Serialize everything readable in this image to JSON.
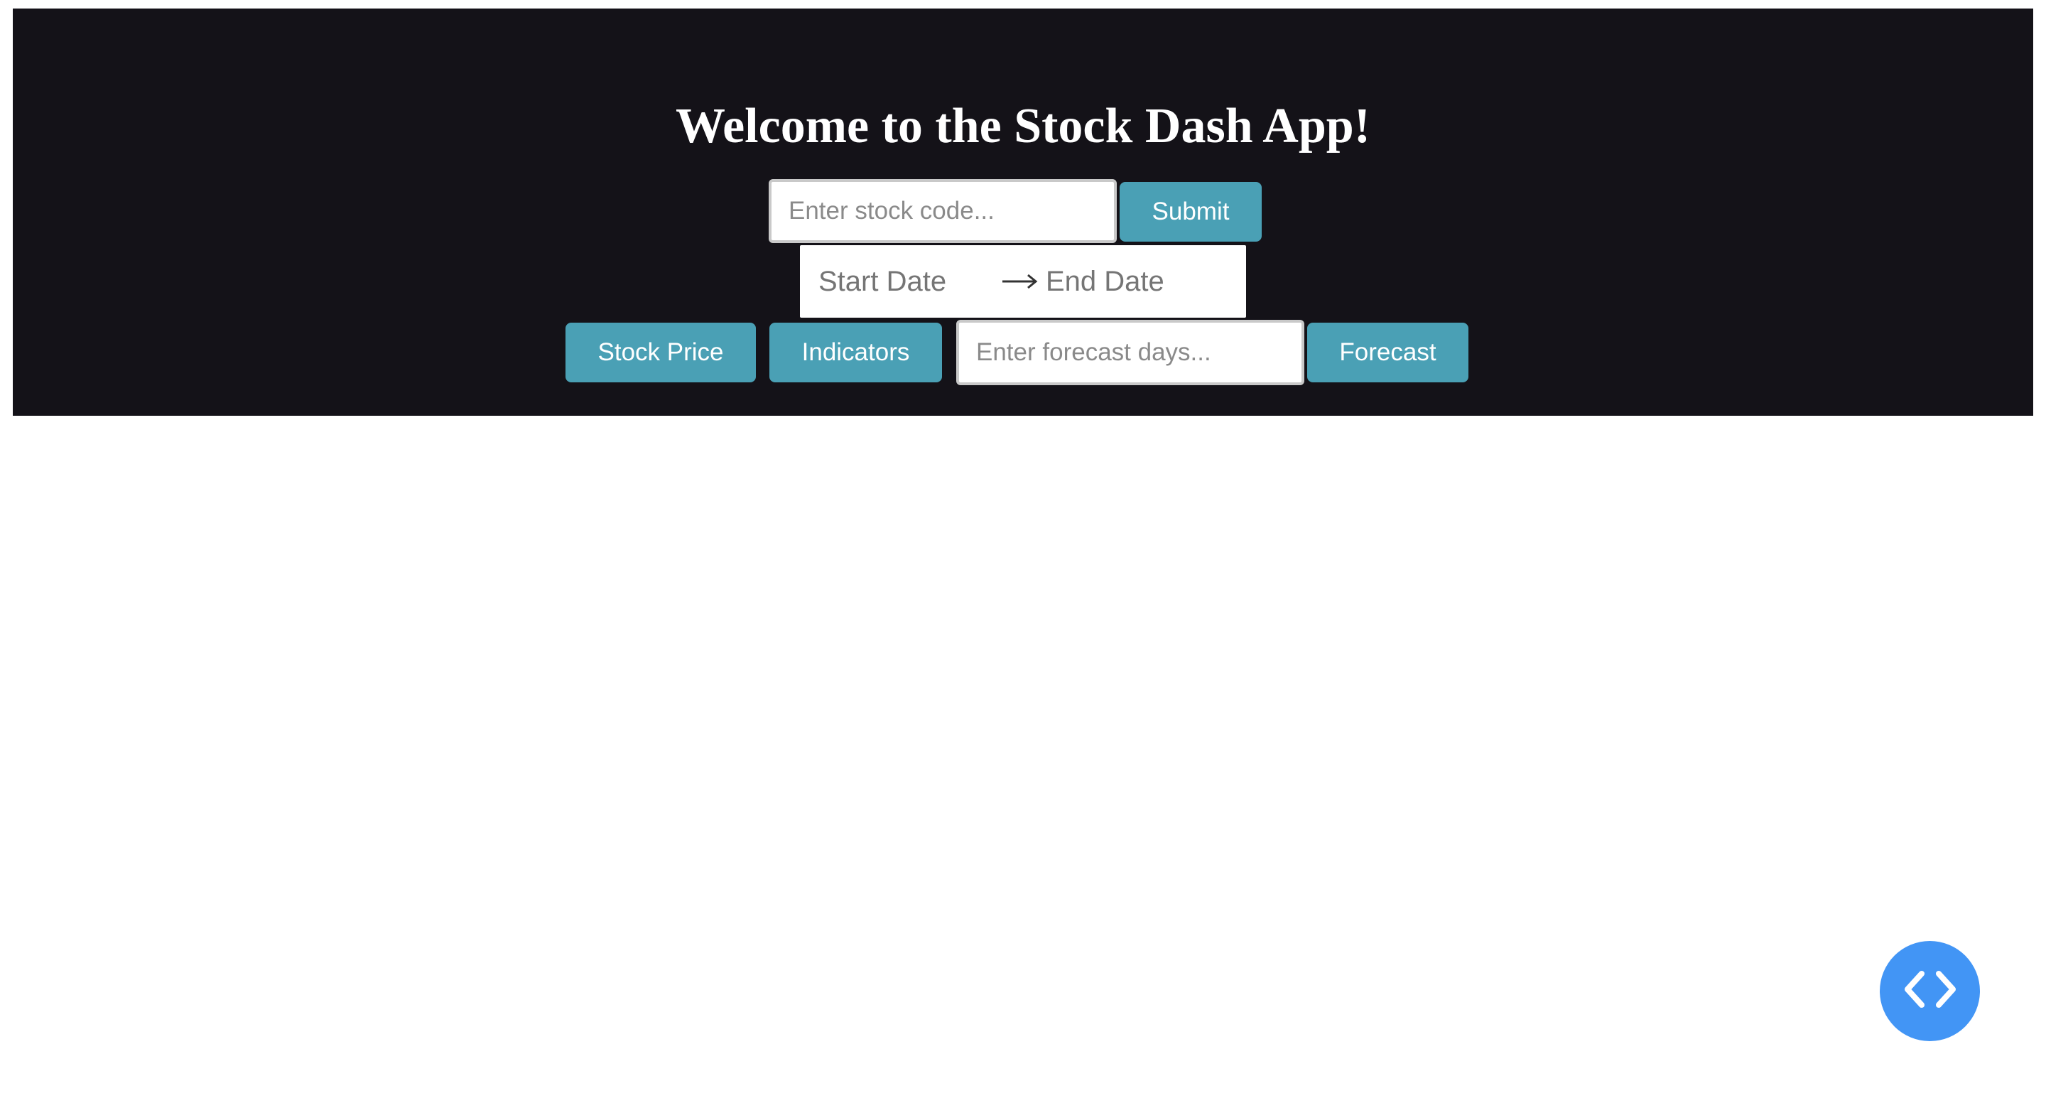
{
  "header": {
    "title": "Welcome to the Stock Dash App!",
    "background_color": "#141218"
  },
  "stock_code": {
    "placeholder": "Enter stock code...",
    "value": ""
  },
  "submit_button": {
    "label": "Submit"
  },
  "date_range": {
    "start_placeholder": "Start Date",
    "end_placeholder": "End Date",
    "separator_icon": "arrow-right-icon"
  },
  "actions": {
    "stock_price_label": "Stock Price",
    "indicators_label": "Indicators",
    "forecast_label": "Forecast"
  },
  "forecast_days": {
    "placeholder": "Enter forecast days...",
    "value": ""
  },
  "debug_fab": {
    "icon": "code-brackets-icon",
    "color": "#4295f5"
  },
  "colors": {
    "button_accent": "#4aa0b5",
    "input_border": "#c9c9c9"
  }
}
